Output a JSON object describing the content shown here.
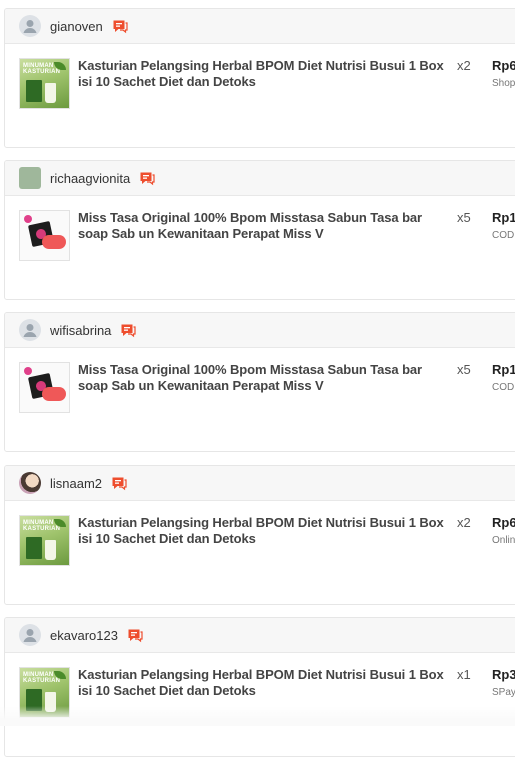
{
  "orders": [
    {
      "username": "gianoven",
      "avatar": "default",
      "product": "Kasturian Pelangsing Herbal BPOM Diet Nutrisi Busui 1 Box isi 10 Sachet Diet dan Detoks",
      "quantity": "x2",
      "price": "Rp6",
      "payment": "Shop",
      "thumb": "kasturian"
    },
    {
      "username": "richaagvionita",
      "avatar": "green",
      "product": "Miss Tasa Original 100% Bpom Misstasa Sabun Tasa bar soap Sab un Kewanitaan Perapat Miss V",
      "quantity": "x5",
      "price": "Rp1",
      "payment": "COD",
      "thumb": "misstasa"
    },
    {
      "username": "wifisabrina",
      "avatar": "default",
      "product": "Miss Tasa Original 100% Bpom Misstasa Sabun Tasa bar soap Sab un Kewanitaan Perapat Miss V",
      "quantity": "x5",
      "price": "Rp1",
      "payment": "COD",
      "thumb": "misstasa"
    },
    {
      "username": "lisnaam2",
      "avatar": "photo",
      "product": "Kasturian Pelangsing Herbal BPOM Diet Nutrisi Busui 1 Box isi 10 Sachet Diet dan Detoks",
      "quantity": "x2",
      "price": "Rp6",
      "payment": "Onlin",
      "thumb": "kasturian"
    },
    {
      "username": "ekavaro123",
      "avatar": "default",
      "product": "Kasturian Pelangsing Herbal BPOM Diet Nutrisi Busui 1 Box isi 10 Sachet Diet dan Detoks",
      "quantity": "x1",
      "price": "Rp3",
      "payment": "SPay",
      "thumb": "kasturian"
    }
  ],
  "thumb_text": {
    "kasturian": "MINUMAN KASTURIAN"
  },
  "colors": {
    "chat_icon": "#ee4d2d",
    "header_bg": "#f7f7f7",
    "border": "#e6e6e6"
  }
}
